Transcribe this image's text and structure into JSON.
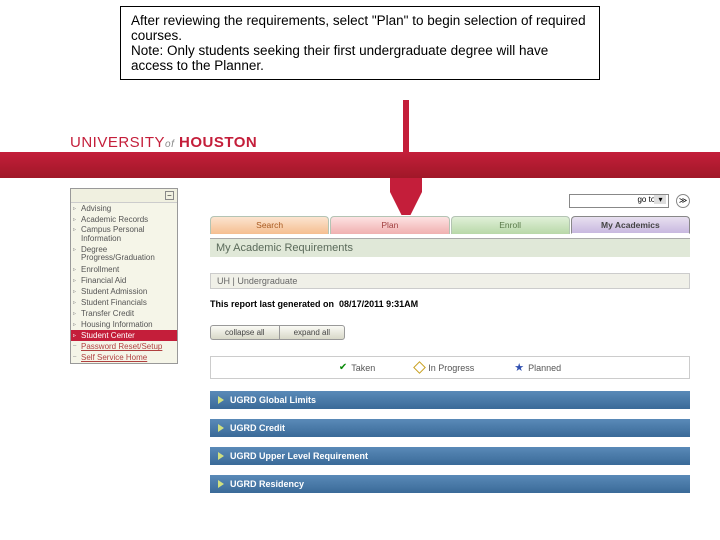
{
  "instruction": {
    "line1": "After reviewing the requirements, select \"Plan\" to begin selection of required courses.",
    "line2": "Note: Only students seeking their first undergraduate degree will have access to the Planner."
  },
  "branding": {
    "university": "UNIVERSITY",
    "of": "of",
    "houston": "HOUSTON"
  },
  "sidebar": {
    "items": [
      {
        "label": "Advising"
      },
      {
        "label": "Academic Records"
      },
      {
        "label": "Campus Personal Information"
      },
      {
        "label": "Degree Progress/Graduation"
      },
      {
        "label": "Enrollment"
      },
      {
        "label": "Financial Aid"
      },
      {
        "label": "Student Admission"
      },
      {
        "label": "Student Financials"
      },
      {
        "label": "Transfer Credit"
      },
      {
        "label": "Housing Information"
      },
      {
        "label": "Student Center"
      },
      {
        "label": "Password Reset/Setup"
      },
      {
        "label": "Self Service Home"
      }
    ]
  },
  "goto": {
    "label": "go to …",
    "btn": "≫"
  },
  "tabs": [
    "Search",
    "Plan",
    "Enroll",
    "My Academics"
  ],
  "page_title": "My Academic Requirements",
  "context": "UH | Undergraduate",
  "report": {
    "prefix": "This report last generated on",
    "ts": "08/17/2011  9:31AM"
  },
  "actions": {
    "collapse": "collapse all",
    "expand": "expand all"
  },
  "legend": {
    "taken": "Taken",
    "progress": "In Progress",
    "planned": "Planned"
  },
  "requirements": [
    "UGRD Global Limits",
    "UGRD Credit",
    "UGRD Upper Level Requirement",
    "UGRD Residency"
  ]
}
